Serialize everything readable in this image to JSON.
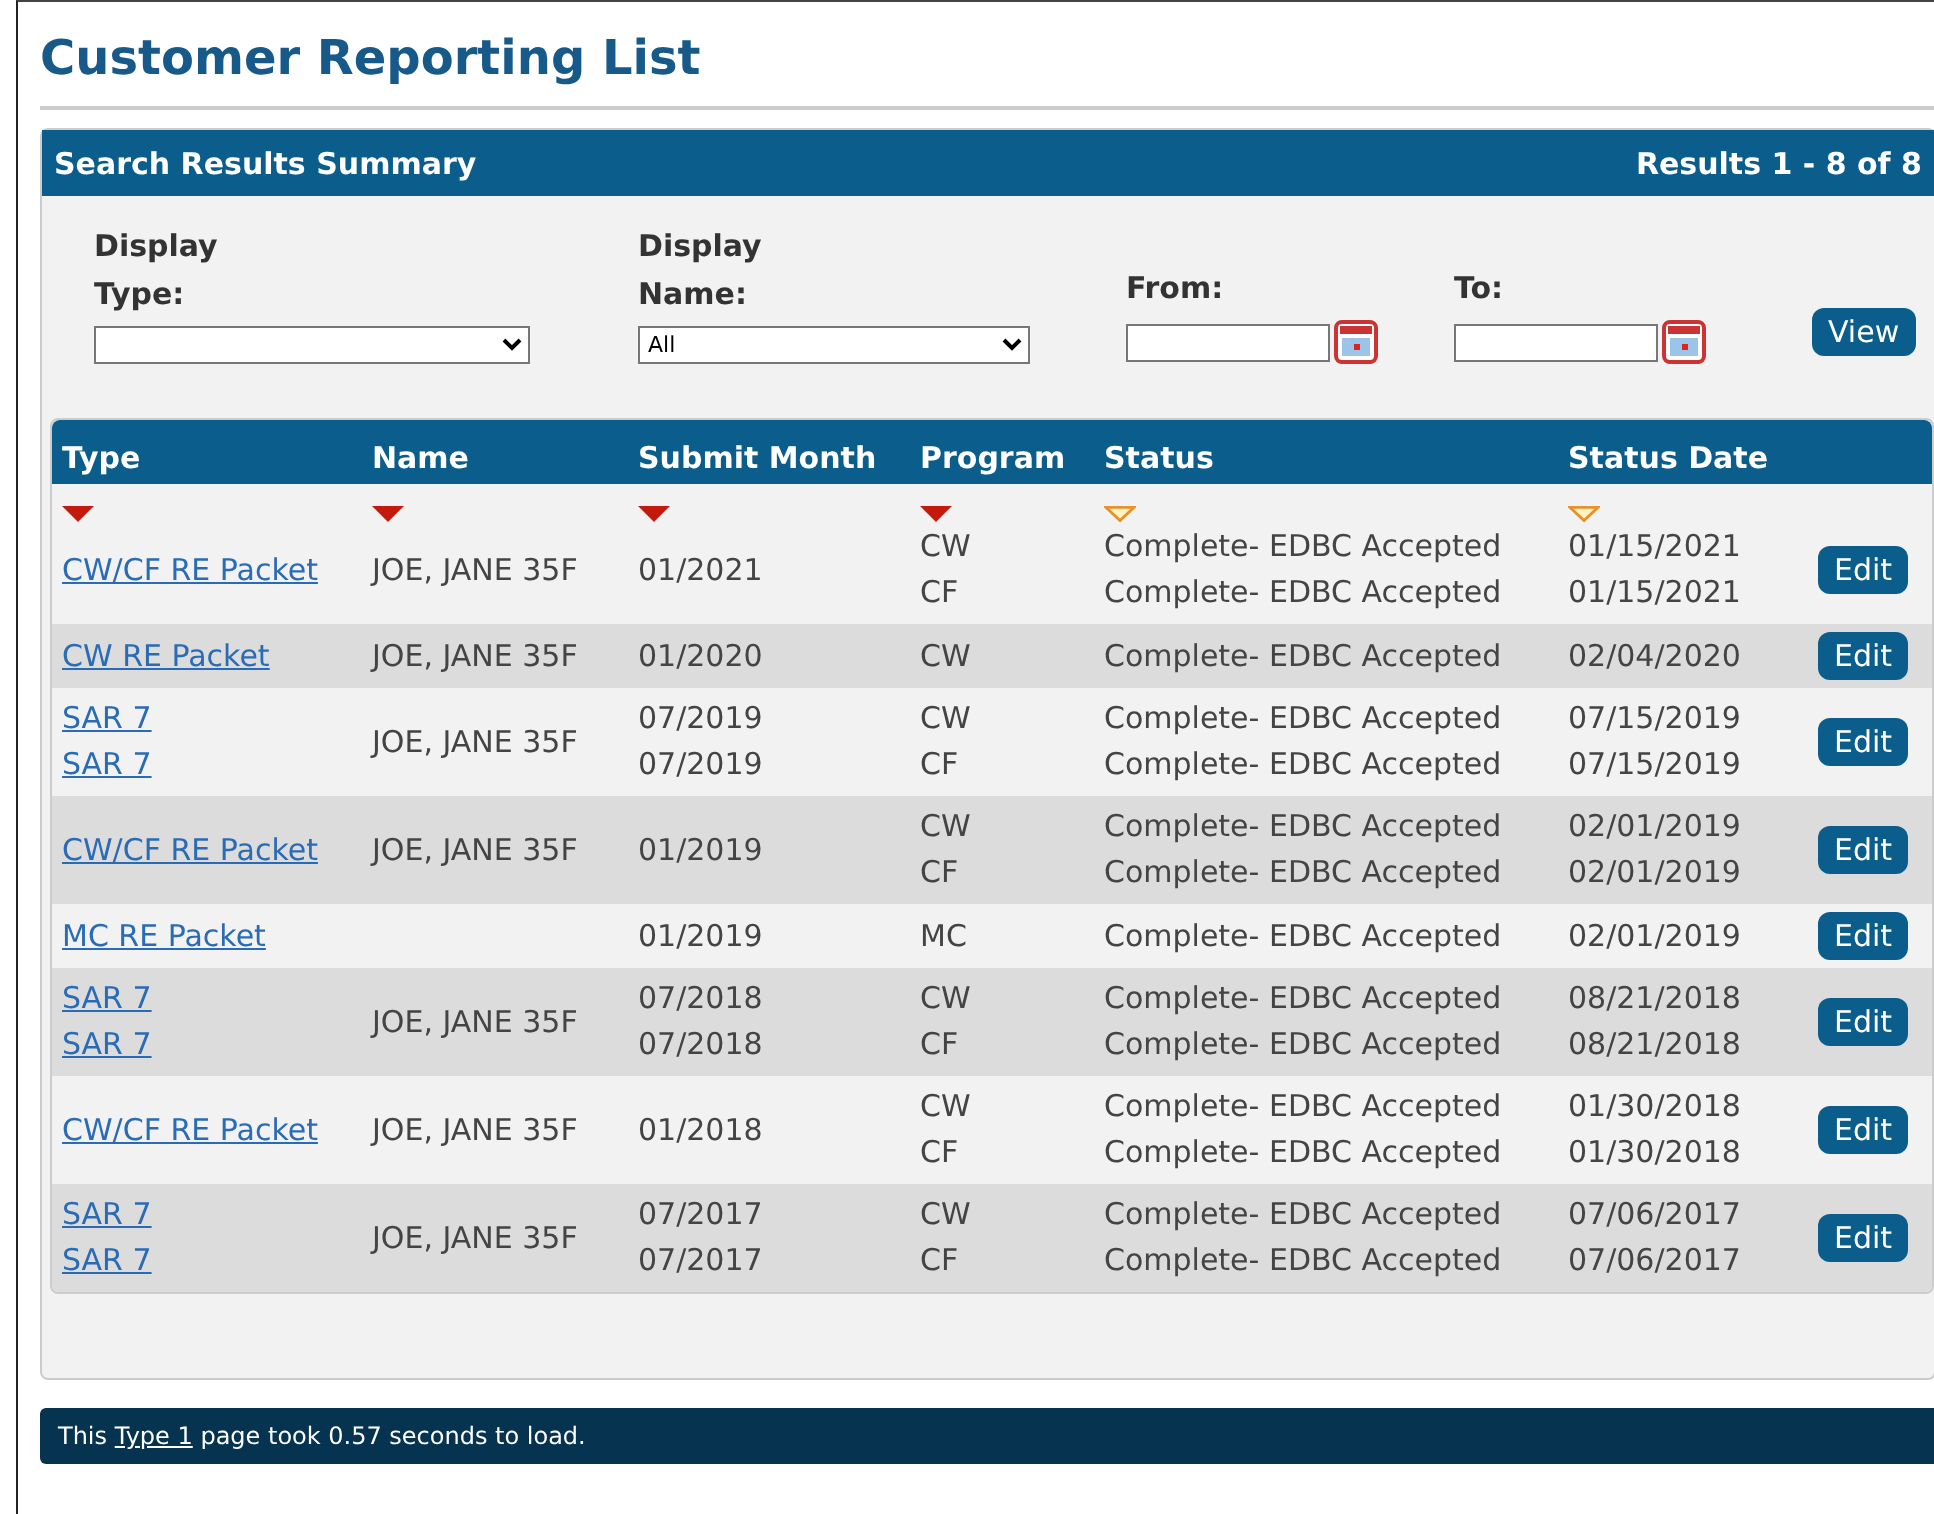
{
  "page_title": "Customer Reporting List",
  "summary": {
    "title": "Search Results Summary",
    "results": "Results 1 - 8 of 8"
  },
  "filters": {
    "display_type": {
      "label": "Display Type:"
    },
    "display_name": {
      "label": "Display Name:",
      "value": "All"
    },
    "from": {
      "label": "From:"
    },
    "to": {
      "label": "To:"
    },
    "view_button": "View"
  },
  "table": {
    "columns": [
      {
        "label": "Type",
        "sort_active": true
      },
      {
        "label": "Name",
        "sort_active": true
      },
      {
        "label": "Submit Month",
        "sort_active": true
      },
      {
        "label": "Program",
        "sort_active": true
      },
      {
        "label": "Status",
        "sort_active": false
      },
      {
        "label": "Status Date",
        "sort_active": false
      }
    ],
    "rows": [
      {
        "types": [
          "CW/CF RE Packet"
        ],
        "name": "JOE, JANE 35F",
        "months": [
          "01/2021"
        ],
        "programs": [
          "CW",
          "CF"
        ],
        "statuses": [
          "Complete- EDBC Accepted",
          "Complete- EDBC Accepted"
        ],
        "dates": [
          "01/15/2021",
          "01/15/2021"
        ],
        "action": "Edit"
      },
      {
        "types": [
          "CW RE Packet"
        ],
        "name": "JOE, JANE 35F",
        "months": [
          "01/2020"
        ],
        "programs": [
          "CW"
        ],
        "statuses": [
          "Complete- EDBC Accepted"
        ],
        "dates": [
          "02/04/2020"
        ],
        "action": "Edit"
      },
      {
        "types": [
          "SAR 7",
          "SAR 7"
        ],
        "name": "JOE, JANE 35F",
        "months": [
          "07/2019",
          "07/2019"
        ],
        "programs": [
          "CW",
          "CF"
        ],
        "statuses": [
          "Complete- EDBC Accepted",
          "Complete- EDBC Accepted"
        ],
        "dates": [
          "07/15/2019",
          "07/15/2019"
        ],
        "action": "Edit"
      },
      {
        "types": [
          "CW/CF RE Packet"
        ],
        "name": "JOE, JANE 35F",
        "months": [
          "01/2019"
        ],
        "programs": [
          "CW",
          "CF"
        ],
        "statuses": [
          "Complete- EDBC Accepted",
          "Complete- EDBC Accepted"
        ],
        "dates": [
          "02/01/2019",
          "02/01/2019"
        ],
        "action": "Edit"
      },
      {
        "types": [
          "MC RE Packet"
        ],
        "months": [
          "01/2019"
        ],
        "programs": [
          "MC"
        ],
        "statuses": [
          "Complete- EDBC Accepted"
        ],
        "dates": [
          "02/01/2019"
        ],
        "action": "Edit"
      },
      {
        "types": [
          "SAR 7",
          "SAR 7"
        ],
        "name": "JOE, JANE 35F",
        "months": [
          "07/2018",
          "07/2018"
        ],
        "programs": [
          "CW",
          "CF"
        ],
        "statuses": [
          "Complete- EDBC Accepted",
          "Complete- EDBC Accepted"
        ],
        "dates": [
          "08/21/2018",
          "08/21/2018"
        ],
        "action": "Edit"
      },
      {
        "types": [
          "CW/CF RE Packet"
        ],
        "name": "JOE, JANE 35F",
        "months": [
          "01/2018"
        ],
        "programs": [
          "CW",
          "CF"
        ],
        "statuses": [
          "Complete- EDBC Accepted",
          "Complete- EDBC Accepted"
        ],
        "dates": [
          "01/30/2018",
          "01/30/2018"
        ],
        "action": "Edit"
      },
      {
        "types": [
          "SAR 7",
          "SAR 7"
        ],
        "name": "JOE, JANE 35F",
        "months": [
          "07/2017",
          "07/2017"
        ],
        "programs": [
          "CW",
          "CF"
        ],
        "statuses": [
          "Complete- EDBC Accepted",
          "Complete- EDBC Accepted"
        ],
        "dates": [
          "07/06/2017",
          "07/06/2017"
        ],
        "action": "Edit"
      }
    ]
  },
  "footer": {
    "before": "This",
    "link": "Type 1",
    "after": "page took 0.57 seconds to load."
  }
}
